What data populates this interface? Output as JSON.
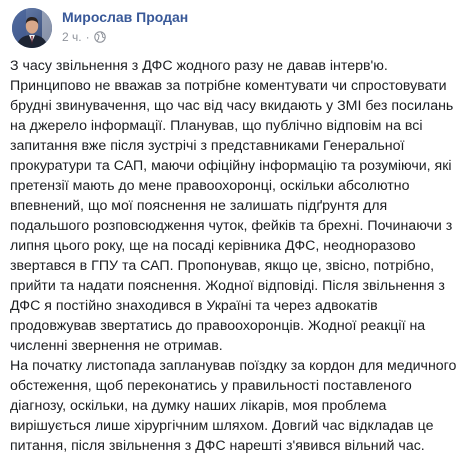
{
  "post": {
    "author": "Мирослав Продан",
    "timestamp": "2 ч.",
    "separator": "·",
    "visibility_icon": "globe-icon",
    "paragraphs": [
      "З часу звільнення з ДФС жодного разу не давав інтерв'ю. Принципово не вважав за потрібне коментувати чи спростовувати брудні звинувачення, що час від часу вкидають у ЗМІ без посилань на джерело інформації. Планував, що публічно відповім на всі запитання вже після зустрічі з представниками Генеральної прокуратури та САП, маючи офіційну інформацію та розуміючи, які претензії мають до мене правоохоронці, оскільки абсолютно впевнений, що мої пояснення не залишать підґрунтя для подальшого розповсюдження чуток, фейків та брехні. Починаючи з липня цього року, ще на посаді керівника ДФС, неодноразово звертався в ГПУ та САП. Пропонував, якщо це, звісно, потрібно, прийти та надати пояснення. Жодної відповіді. Після звільнення з ДФС я постійно знаходився в Україні та через адвокатів продовжував звертатись до правоохоронців. Жодної реакції на численні звернення не отримав.",
      "На початку листопада запланував поїздку за кордон для медичного обстеження, щоб переконатись у правильності поставленого діагнозу, оскільки, на думку наших лікарів, моя проблема вирішується лише хірургічним шляхом. Довгий час відкладав це питання, після звільнення з ДФС нарешті з'явився вільний час."
    ]
  },
  "colors": {
    "author_link": "#385898",
    "meta_text": "#90949c",
    "body_text": "#1c1e21",
    "background": "#ffffff"
  }
}
